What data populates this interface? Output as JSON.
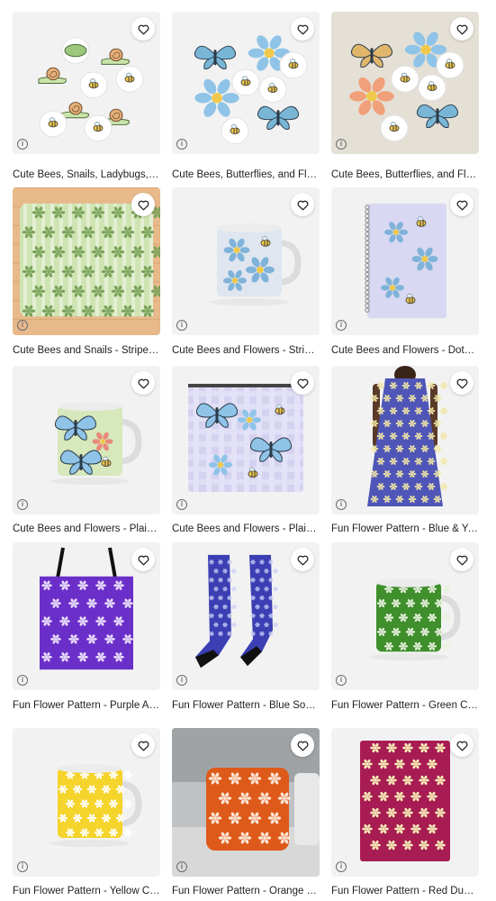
{
  "products": [
    {
      "title": "Cute Bees, Snails, Ladybugs, Bees and Leaves Sticker Pack",
      "image": "sticker-pack-snails"
    },
    {
      "title": "Cute Bees, Butterflies, and Flowers Sticker Pack",
      "image": "sticker-pack-butterflies-white"
    },
    {
      "title": "Cute Bees, Butterflies, and Flowers Sticker Pack",
      "image": "sticker-pack-butterflies-beige"
    },
    {
      "title": "Cute Bees and Snails - Stripes Bath Mat",
      "image": "bath-mat-green"
    },
    {
      "title": "Cute Bees and Flowers - Stripes Mug",
      "image": "mug-flowers-stripes"
    },
    {
      "title": "Cute Bees and Flowers - Dots Spiral Notebook",
      "image": "notebook-dots"
    },
    {
      "title": "Cute Bees and Flowers - Plaid Mug",
      "image": "mug-plaid-green"
    },
    {
      "title": "Cute Bees and Flowers - Plaid Zipper Pouch",
      "image": "zipper-pouch-plaid"
    },
    {
      "title": "Fun Flower Pattern - Blue & Yellow A-Line Dress",
      "image": "dress-blue"
    },
    {
      "title": "Fun Flower Pattern - Purple All Over Print Tote Bag",
      "image": "tote-purple"
    },
    {
      "title": "Fun Flower Pattern - Blue Socks",
      "image": "socks-blue"
    },
    {
      "title": "Fun Flower Pattern - Green Classic Mug",
      "image": "mug-green"
    },
    {
      "title": "Fun Flower Pattern - Yellow Classic Mug",
      "image": "mug-yellow"
    },
    {
      "title": "Fun Flower Pattern - Orange Throw Pillow",
      "image": "pillow-orange"
    },
    {
      "title": "Fun Flower Pattern - Red Duvet Cover",
      "image": "duvet-red"
    }
  ],
  "icons": {
    "favorite": "heart-icon",
    "info": "info-icon",
    "info_glyph": "i"
  },
  "colors": {
    "tile_bg": "#f2f2f2",
    "beige_bg": "#e5e0d6",
    "wood": "#e8b98a",
    "heart_stroke": "#1f1f24"
  }
}
